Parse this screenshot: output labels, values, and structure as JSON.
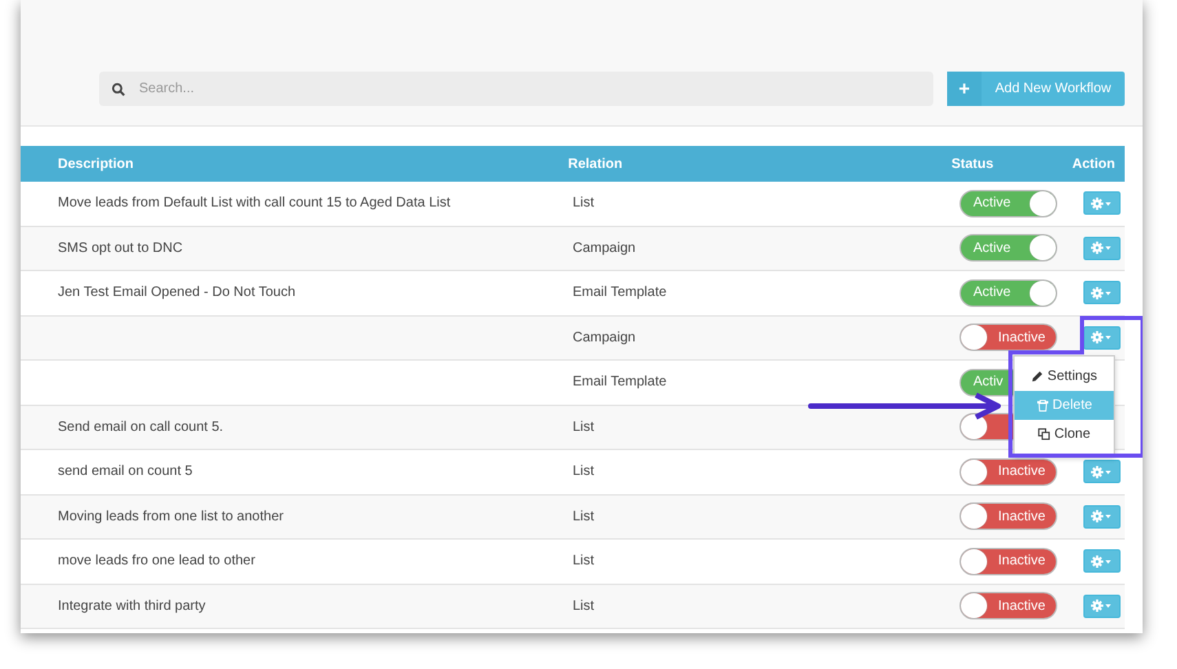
{
  "search": {
    "placeholder": "Search..."
  },
  "add_button": {
    "icon": "+",
    "label": "Add New Workflow"
  },
  "table": {
    "columns": [
      "Description",
      "Relation",
      "Status",
      "Action"
    ],
    "rows": [
      {
        "description": "Move leads from Default List with call count 15 to Aged Data List",
        "relation": "List",
        "status": {
          "on": true,
          "label": "Active"
        },
        "action_button": true
      },
      {
        "description": "SMS opt out to DNC",
        "relation": "Campaign",
        "status": {
          "on": true,
          "label": "Active"
        },
        "action_button": true
      },
      {
        "description": "Jen Test Email Opened - Do Not Touch",
        "relation": "Email Template",
        "status": {
          "on": true,
          "label": "Active"
        },
        "action_button": true
      },
      {
        "relation": "Campaign",
        "status": {
          "on": false,
          "label": "Inactive"
        },
        "action_button": true
      },
      {
        "relation": "Email Template",
        "status": {
          "on": true,
          "label": "Activ"
        },
        "action_button": false
      },
      {
        "description": "Send email on call count 5.",
        "relation": "List",
        "status": {
          "on": false
        },
        "action_button": false
      },
      {
        "description": "send email on count 5",
        "relation": "List",
        "status": {
          "on": false,
          "label": "Inactive"
        },
        "action_button": true
      },
      {
        "description": "Moving leads from one list to another",
        "relation": "List",
        "status": {
          "on": false,
          "label": "Inactive"
        },
        "action_button": true
      },
      {
        "description": "move leads fro one lead to other",
        "relation": "List",
        "status": {
          "on": false,
          "label": "Inactive"
        },
        "action_button": true
      },
      {
        "description": "Integrate with third party",
        "relation": "List",
        "status": {
          "on": false,
          "label": "Inactive"
        },
        "action_button": true
      }
    ]
  },
  "action_menu": {
    "items": [
      {
        "kind": "settings",
        "label": "Settings",
        "selected": false
      },
      {
        "kind": "delete",
        "label": "Delete",
        "selected": true
      },
      {
        "kind": "clone",
        "label": "Clone",
        "selected": false
      }
    ]
  }
}
